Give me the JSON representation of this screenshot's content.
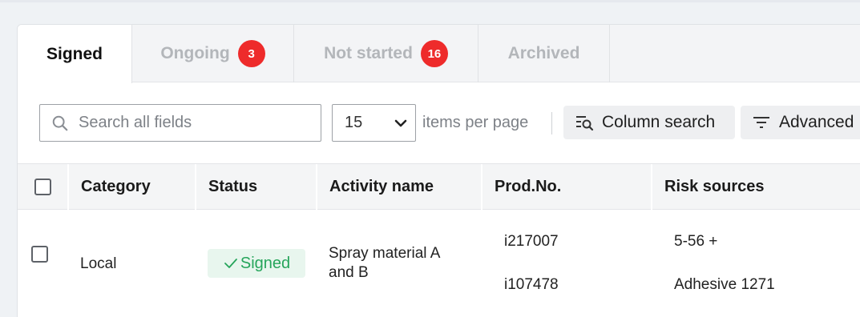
{
  "tabs": [
    {
      "label": "Signed",
      "active": true
    },
    {
      "label": "Ongoing",
      "badge": "3"
    },
    {
      "label": "Not started",
      "badge": "16"
    },
    {
      "label": "Archived"
    }
  ],
  "toolbar": {
    "search_placeholder": "Search all fields",
    "per_page_value": "15",
    "per_page_label": "items per page",
    "column_search_label": "Column search",
    "advanced_label": "Advanced"
  },
  "table": {
    "columns": [
      "Category",
      "Status",
      "Activity name",
      "Prod.No.",
      "Risk sources"
    ],
    "rows": [
      {
        "category": "Local",
        "status": "Signed",
        "activity_name": "Spray material A and B",
        "prod_no": [
          "i217007",
          "i107478"
        ],
        "risk_sources": [
          "5-56 +",
          "Adhesive 1271"
        ]
      }
    ]
  },
  "colors": {
    "badge": "#ee2b2b",
    "status_signed_bg": "#e8f6ee",
    "status_signed_text": "#26a55b"
  }
}
